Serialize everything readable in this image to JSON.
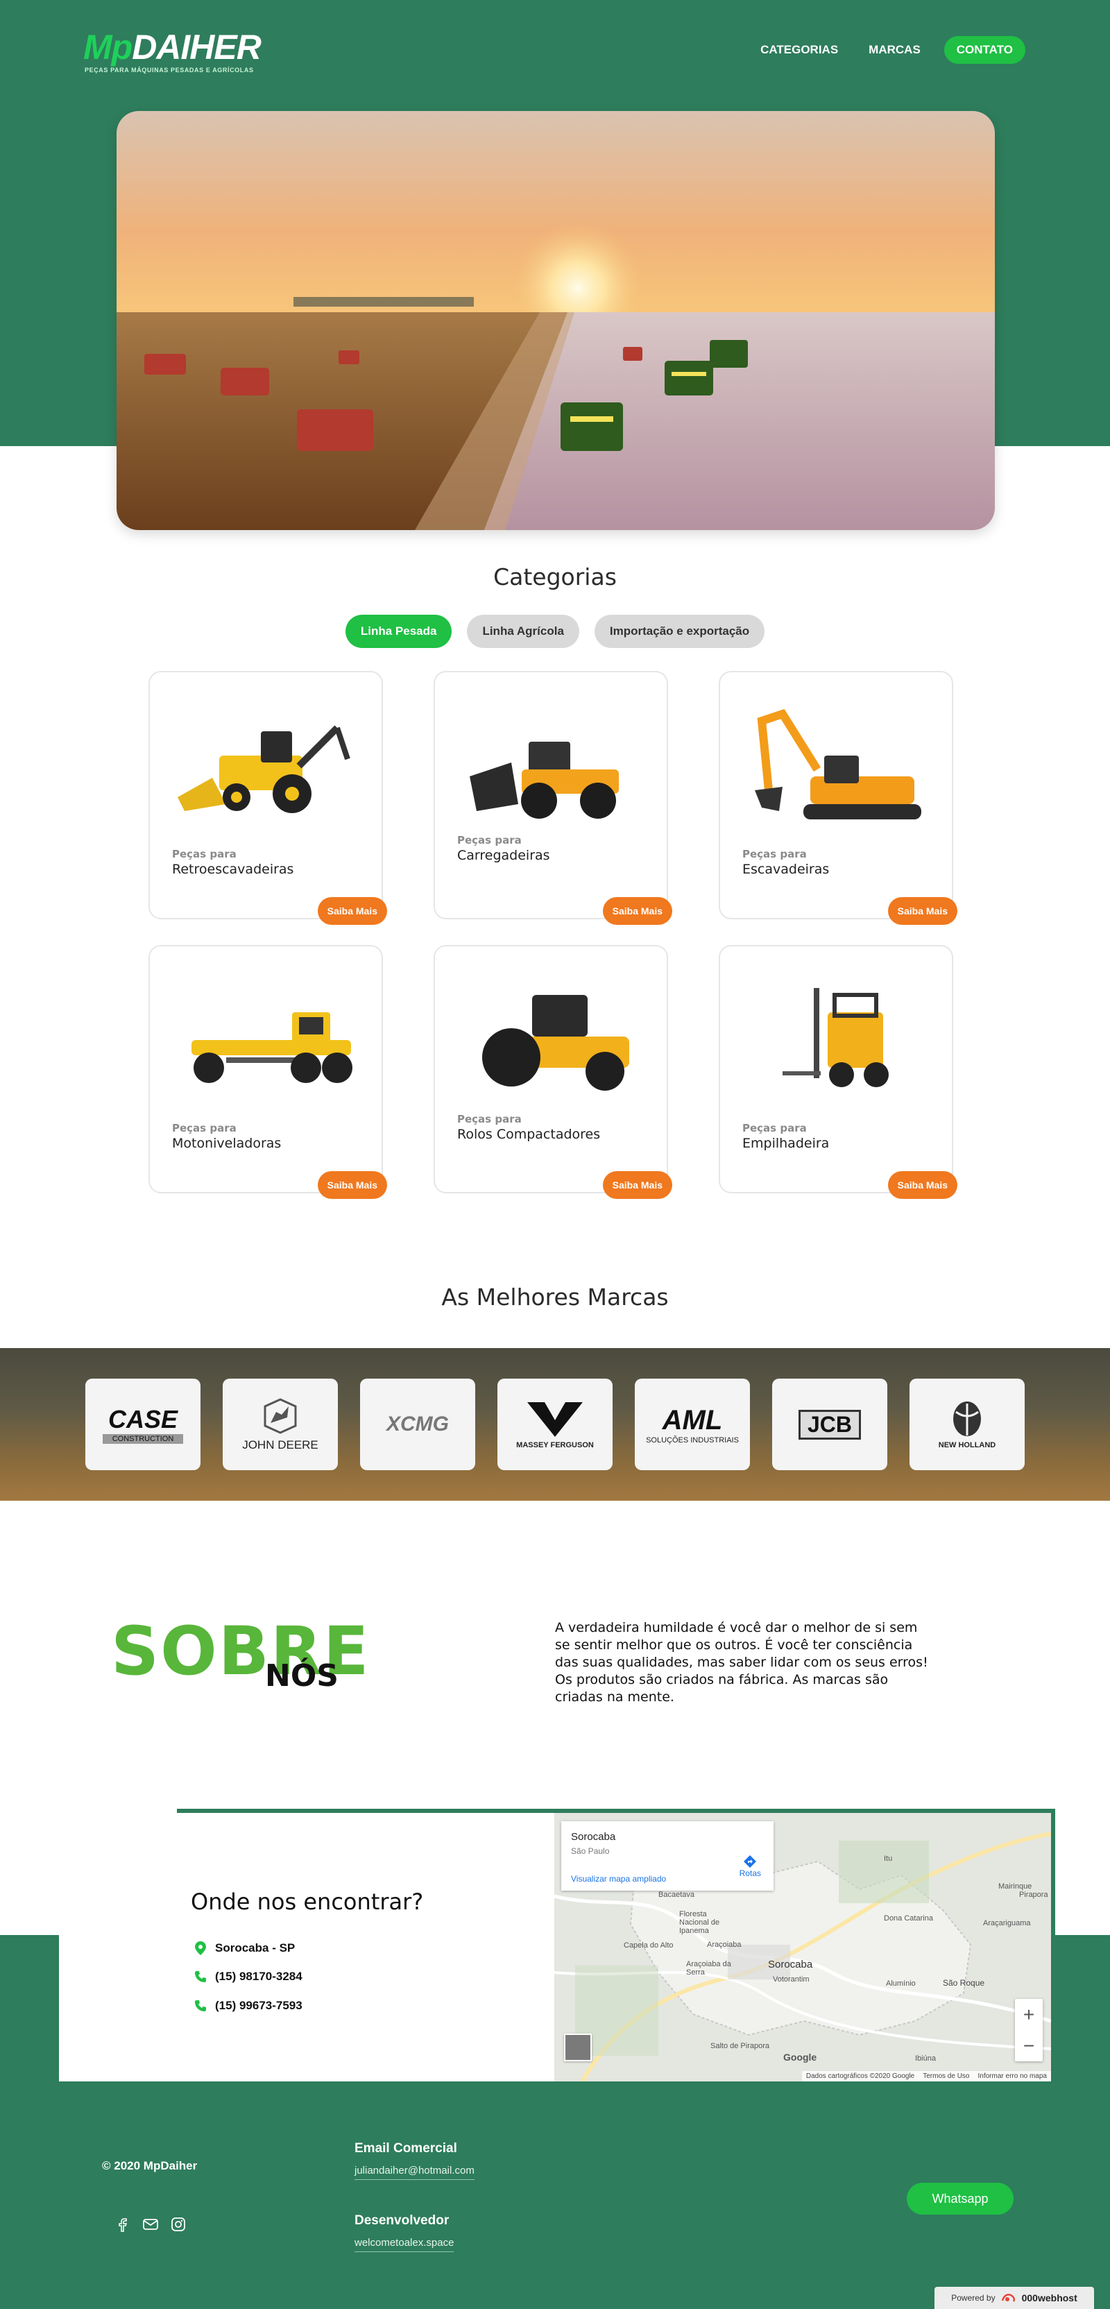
{
  "brand": {
    "logo_mp": "Mp",
    "logo_name": "DAIHER",
    "logo_tagline": "PEÇAS PARA MÁQUINAS PESADAS E AGRÍCOLAS"
  },
  "nav": {
    "items": [
      "CATEGORIAS",
      "MARCAS"
    ],
    "contact_label": "CONTATO"
  },
  "categories": {
    "title": "Categorias",
    "tabs": [
      "Linha Pesada",
      "Linha Agrícola",
      "Importação e exportação"
    ],
    "active_tab": "Linha Pesada",
    "prefix": "Peças para",
    "button_label": "Saiba Mais",
    "items": [
      "Retroescavadeiras",
      "Carregadeiras",
      "Escavadeiras",
      "Motoniveladoras",
      "Rolos Compactadores",
      "Empilhadeira"
    ]
  },
  "brands": {
    "title": "As Melhores Marcas",
    "logos": [
      {
        "name": "CASE",
        "sub": "CONSTRUCTION"
      },
      {
        "name": "JOHN DEERE",
        "sub": ""
      },
      {
        "name": "XCMG",
        "sub": ""
      },
      {
        "name": "MASSEY FERGUSON",
        "sub": ""
      },
      {
        "name": "AML",
        "sub": "SOLUÇÕES INDUSTRIAIS"
      },
      {
        "name": "JCB",
        "sub": ""
      },
      {
        "name": "NEW HOLLAND",
        "sub": ""
      }
    ]
  },
  "about": {
    "title_big": "SOBRE",
    "title_small": "NÓS",
    "paragraph1": "A verdadeira humildade é você dar o melhor de si sem se sentir melhor que os outros. É você ter consciência das suas qualidades, mas saber lidar com os seus erros!",
    "paragraph2": "Os produtos são criados na fábrica. As marcas são criadas na mente."
  },
  "location": {
    "title": "Onde nos encontrar?",
    "city": "Sorocaba - SP",
    "phone1": "(15) 98170-3284",
    "phone2": "(15) 99673-7593"
  },
  "map": {
    "place": "Sorocaba",
    "region": "São Paulo",
    "link": "Visualizar mapa ampliado",
    "directions": "Rotas",
    "city_label": "Sorocaba",
    "labels": [
      "Itu",
      "Bacaetava",
      "Floresta Nacional de Ipanema",
      "Araçoiaba",
      "Capela do Alto",
      "Araçoiaba da Serra",
      "Votorantim",
      "Dona Catarina",
      "Araçariguama",
      "Mairinque",
      "Alumínio",
      "São Roque",
      "Salto de Pirapora",
      "Ibiúna",
      "Pirapora"
    ],
    "attribution": "Dados cartográficos ©2020 Google",
    "terms": "Termos de Uso",
    "report": "Informar erro no mapa",
    "google": "Google"
  },
  "footer": {
    "copyright": "© 2020 MpDaiher",
    "email_heading": "Email Comercial",
    "email": "juliandaiher@hotmail.com",
    "dev_heading": "Desenvolvedor",
    "dev_site": "welcometoalex.space",
    "whatsapp": "Whatsapp",
    "powered_by": "Powered by",
    "host": "000webhost"
  },
  "colors": {
    "brand_green": "#2e7d5d",
    "accent_green": "#1fc044",
    "orange": "#f0781e"
  }
}
